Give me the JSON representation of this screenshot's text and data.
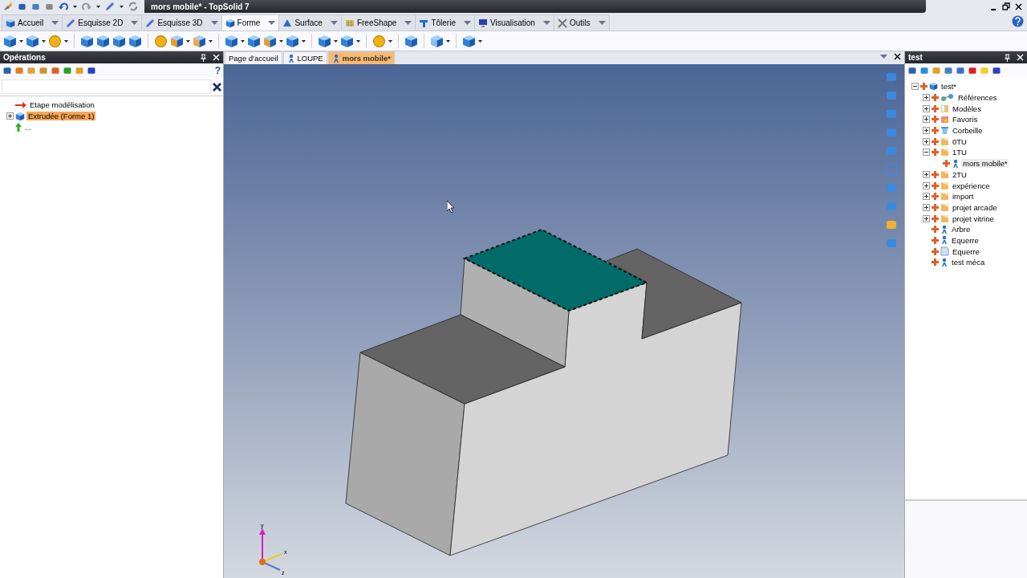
{
  "window": {
    "title": "mors mobile* - TopSolid 7"
  },
  "ribbon_tabs": [
    {
      "label": "Accueil",
      "selected": false
    },
    {
      "label": "Esquisse 2D",
      "selected": false
    },
    {
      "label": "Esquisse 3D",
      "selected": false
    },
    {
      "label": "Forme",
      "selected": true
    },
    {
      "label": "Surface",
      "selected": false
    },
    {
      "label": "FreeShape",
      "selected": false
    },
    {
      "label": "Tôlerie",
      "selected": false
    },
    {
      "label": "Visualisation",
      "selected": false
    },
    {
      "label": "Outils",
      "selected": false
    }
  ],
  "operations_panel": {
    "title": "Opérations",
    "help": "?",
    "tree": [
      {
        "label": "Etape modélisation",
        "kind": "step",
        "selected": false
      },
      {
        "label": "Extrudée (Forme 1)",
        "kind": "extrude",
        "selected": true,
        "expanded": false
      },
      {
        "label": "...",
        "kind": "next",
        "selected": false
      }
    ]
  },
  "axes": {
    "y": "y",
    "x": "x",
    "z": "z"
  },
  "doc_tabs": [
    {
      "label": "Page d'accueil",
      "kind": "home",
      "selected": false
    },
    {
      "label": "LOUPE",
      "kind": "part",
      "selected": false
    },
    {
      "label": "mors mobile*",
      "kind": "part",
      "selected": true
    }
  ],
  "project_panel": {
    "title": "test",
    "tree": [
      {
        "label": "test*",
        "kind": "root",
        "expanded": true,
        "selected": false,
        "children": [
          {
            "label": "Références",
            "kind": "references",
            "expanded": false,
            "selected": false
          },
          {
            "label": "Modèles",
            "kind": "models",
            "expanded": false,
            "selected": false
          },
          {
            "label": "Favoris",
            "kind": "favorites",
            "expanded": false,
            "selected": false
          },
          {
            "label": "Corbeille",
            "kind": "trash",
            "expanded": false,
            "selected": false
          },
          {
            "label": "0TU",
            "kind": "folder",
            "expanded": false,
            "selected": false
          },
          {
            "label": "1TU",
            "kind": "folder",
            "expanded": true,
            "selected": false,
            "children": [
              {
                "label": "mors mobile*",
                "kind": "part",
                "selected": true
              }
            ]
          },
          {
            "label": "2TU",
            "kind": "folder",
            "expanded": false,
            "selected": false
          },
          {
            "label": "expérience",
            "kind": "folder",
            "expanded": false,
            "selected": false
          },
          {
            "label": "import",
            "kind": "folder",
            "expanded": false,
            "selected": false
          },
          {
            "label": "projet arcade",
            "kind": "folder",
            "expanded": false,
            "selected": false
          },
          {
            "label": "projet vitrine",
            "kind": "folder",
            "expanded": false,
            "selected": false
          },
          {
            "label": "Arbre",
            "kind": "part",
            "selected": false
          },
          {
            "label": "Equerre",
            "kind": "part",
            "selected": false
          },
          {
            "label": "Equerre",
            "kind": "document",
            "selected": false
          },
          {
            "label": "test méca",
            "kind": "part",
            "selected": false
          }
        ]
      }
    ]
  }
}
